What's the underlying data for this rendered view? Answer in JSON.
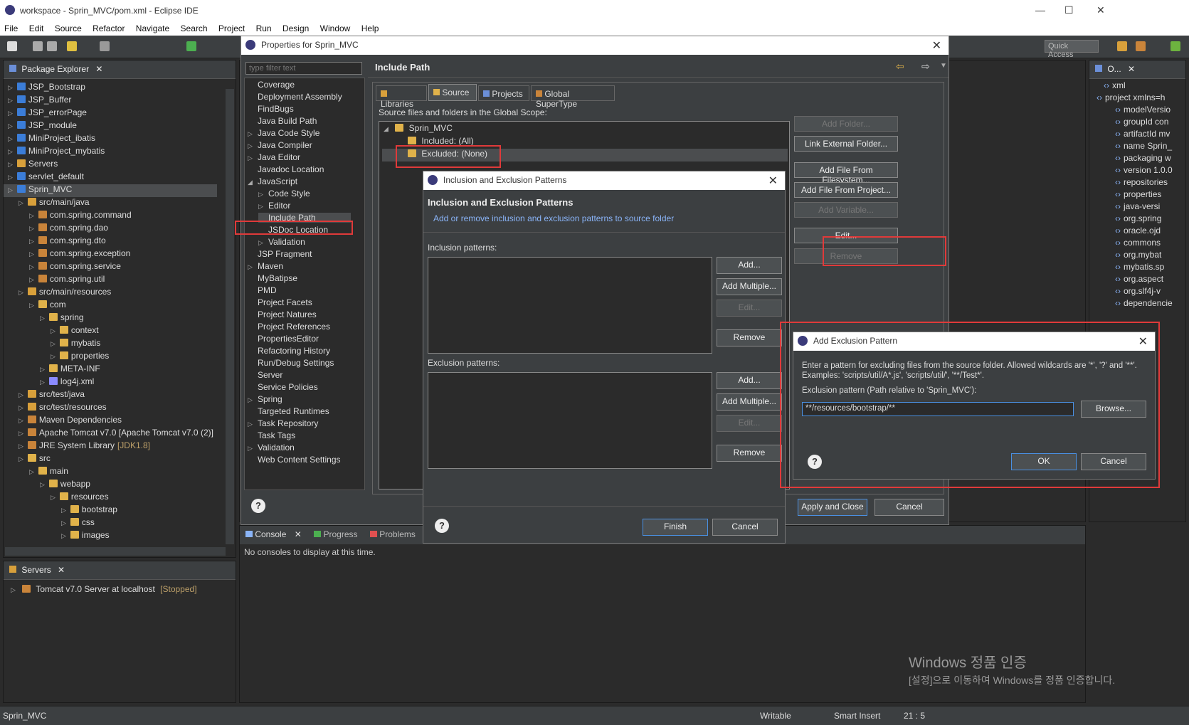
{
  "window": {
    "title": "workspace - Sprin_MVC/pom.xml - Eclipse IDE",
    "min": "—",
    "max": "☐",
    "close": "✕"
  },
  "menu": [
    "File",
    "Edit",
    "Source",
    "Refactor",
    "Navigate",
    "Search",
    "Project",
    "Run",
    "Design",
    "Window",
    "Help"
  ],
  "quick_access": "Quick Access",
  "package_explorer": {
    "tab": "Package Explorer",
    "items": [
      {
        "label": "JSP_Bootstrap",
        "indent": 0,
        "color": "#3b7dd8"
      },
      {
        "label": "JSP_Buffer",
        "indent": 0,
        "color": "#3b7dd8"
      },
      {
        "label": "JSP_errorPage",
        "indent": 0,
        "color": "#3b7dd8"
      },
      {
        "label": "JSP_module",
        "indent": 0,
        "color": "#3b7dd8"
      },
      {
        "label": "MiniProject_ibatis",
        "indent": 0,
        "color": "#3b7dd8"
      },
      {
        "label": "MiniProject_mybatis",
        "indent": 0,
        "color": "#3b7dd8"
      },
      {
        "label": "Servers",
        "indent": 0,
        "color": "#d8a03b"
      },
      {
        "label": "servlet_default",
        "indent": 0,
        "color": "#3b7dd8"
      },
      {
        "label": "Sprin_MVC",
        "indent": 0,
        "color": "#3b7dd8",
        "selected": true
      },
      {
        "label": "src/main/java",
        "indent": 1,
        "color": "#d8a03b"
      },
      {
        "label": "com.spring.command",
        "indent": 2,
        "color": "#c9843a"
      },
      {
        "label": "com.spring.dao",
        "indent": 2,
        "color": "#c9843a"
      },
      {
        "label": "com.spring.dto",
        "indent": 2,
        "color": "#c9843a"
      },
      {
        "label": "com.spring.exception",
        "indent": 2,
        "color": "#c9843a"
      },
      {
        "label": "com.spring.service",
        "indent": 2,
        "color": "#c9843a"
      },
      {
        "label": "com.spring.util",
        "indent": 2,
        "color": "#c9843a"
      },
      {
        "label": "src/main/resources",
        "indent": 1,
        "color": "#d8a03b"
      },
      {
        "label": "com",
        "indent": 2,
        "color": "#e0b24a"
      },
      {
        "label": "spring",
        "indent": 3,
        "color": "#e0b24a"
      },
      {
        "label": "context",
        "indent": 4,
        "color": "#e0b24a"
      },
      {
        "label": "mybatis",
        "indent": 4,
        "color": "#e0b24a"
      },
      {
        "label": "properties",
        "indent": 4,
        "color": "#e0b24a"
      },
      {
        "label": "META-INF",
        "indent": 3,
        "color": "#e0b24a"
      },
      {
        "label": "log4j.xml",
        "indent": 3,
        "color": "#8a8aff"
      },
      {
        "label": "src/test/java",
        "indent": 1,
        "color": "#d8a03b"
      },
      {
        "label": "src/test/resources",
        "indent": 1,
        "color": "#d8a03b"
      },
      {
        "label": "Maven Dependencies",
        "indent": 1,
        "color": "#c9843a"
      },
      {
        "label": "Apache Tomcat v7.0 [Apache Tomcat v7.0 (2)]",
        "indent": 1,
        "color": "#c9843a"
      },
      {
        "label": "JRE System Library",
        "suffix": "[JDK1.8]",
        "indent": 1,
        "color": "#c9843a"
      },
      {
        "label": "src",
        "indent": 1,
        "color": "#e0b24a"
      },
      {
        "label": "main",
        "indent": 2,
        "color": "#e0b24a"
      },
      {
        "label": "webapp",
        "indent": 3,
        "color": "#e0b24a"
      },
      {
        "label": "resources",
        "indent": 4,
        "color": "#e0b24a"
      },
      {
        "label": "bootstrap",
        "indent": 5,
        "color": "#e0b24a"
      },
      {
        "label": "css",
        "indent": 5,
        "color": "#e0b24a"
      },
      {
        "label": "images",
        "indent": 5,
        "color": "#e0b24a"
      }
    ]
  },
  "servers": {
    "tab": "Servers",
    "item": "Tomcat v7.0 Server at localhost",
    "status": "[Stopped]"
  },
  "outline": {
    "tab": "O...",
    "items": [
      "xml",
      "project xmlns=h",
      "modelVersio",
      "groupId  con",
      "artifactId  mv",
      "name  Sprin_",
      "packaging  w",
      "version  1.0.0",
      "repositories",
      "properties",
      "java-versi",
      "org.spring",
      "oracle.ojd",
      "commons",
      "org.mybat",
      "mybatis.sp",
      "org.aspect",
      "org.slf4j-v",
      "dependencie"
    ]
  },
  "console": {
    "tabs": [
      "Console",
      "Progress",
      "Problems"
    ],
    "message": "No consoles to display at this time."
  },
  "watermark": {
    "line1": "Windows 정품 인증",
    "line2": "[설정]으로 이동하여 Windows를 정품 인증합니다."
  },
  "statusbar": {
    "left": "Sprin_MVC",
    "writable": "Writable",
    "insert": "Smart Insert",
    "pos": "21 : 5"
  },
  "properties_dialog": {
    "title": "Properties for Sprin_MVC",
    "filter_placeholder": "type filter text",
    "header": "Include Path",
    "nav": [
      {
        "label": "Coverage",
        "indent": 0
      },
      {
        "label": "Deployment Assembly",
        "indent": 0
      },
      {
        "label": "FindBugs",
        "indent": 0
      },
      {
        "label": "Java Build Path",
        "indent": 0
      },
      {
        "label": "Java Code Style",
        "indent": 0,
        "exp": "▷"
      },
      {
        "label": "Java Compiler",
        "indent": 0,
        "exp": "▷"
      },
      {
        "label": "Java Editor",
        "indent": 0,
        "exp": "▷"
      },
      {
        "label": "Javadoc Location",
        "indent": 0
      },
      {
        "label": "JavaScript",
        "indent": 0,
        "exp": "◢"
      },
      {
        "label": "Code Style",
        "indent": 1,
        "exp": "▷"
      },
      {
        "label": "Editor",
        "indent": 1,
        "exp": "▷"
      },
      {
        "label": "Include Path",
        "indent": 1,
        "selected": true
      },
      {
        "label": "JSDoc Location",
        "indent": 1
      },
      {
        "label": "Validation",
        "indent": 1,
        "exp": "▷"
      },
      {
        "label": "JSP Fragment",
        "indent": 0
      },
      {
        "label": "Maven",
        "indent": 0,
        "exp": "▷"
      },
      {
        "label": "MyBatipse",
        "indent": 0
      },
      {
        "label": "PMD",
        "indent": 0
      },
      {
        "label": "Project Facets",
        "indent": 0
      },
      {
        "label": "Project Natures",
        "indent": 0
      },
      {
        "label": "Project References",
        "indent": 0
      },
      {
        "label": "PropertiesEditor",
        "indent": 0
      },
      {
        "label": "Refactoring History",
        "indent": 0
      },
      {
        "label": "Run/Debug Settings",
        "indent": 0
      },
      {
        "label": "Server",
        "indent": 0
      },
      {
        "label": "Service Policies",
        "indent": 0
      },
      {
        "label": "Spring",
        "indent": 0,
        "exp": "▷"
      },
      {
        "label": "Targeted Runtimes",
        "indent": 0
      },
      {
        "label": "Task Repository",
        "indent": 0,
        "exp": "▷"
      },
      {
        "label": "Task Tags",
        "indent": 0
      },
      {
        "label": "Validation",
        "indent": 0,
        "exp": "▷"
      },
      {
        "label": "Web Content Settings",
        "indent": 0
      }
    ],
    "tabs": [
      "Libraries",
      "Source",
      "Projects",
      "Global SuperType"
    ],
    "scope_label": "Source files and folders in the Global Scope:",
    "tree": {
      "root": "Sprin_MVC",
      "included": "Included: (All)",
      "excluded": "Excluded: (None)"
    },
    "side_buttons": [
      "Add Folder...",
      "Link External Folder...",
      "Add File From Filesystem...",
      "Add File From Project...",
      "Add Variable...",
      "Edit...",
      "Remove"
    ],
    "apply_close": "Apply and Close",
    "cancel": "Cancel"
  },
  "incl_dialog": {
    "title": "Inclusion and Exclusion Patterns",
    "header": "Inclusion and Exclusion Patterns",
    "subheader": "Add or remove inclusion and exclusion patterns to source folder",
    "inclusion_label": "Inclusion patterns:",
    "exclusion_label": "Exclusion patterns:",
    "buttons": [
      "Add...",
      "Add Multiple...",
      "Edit...",
      "Remove"
    ],
    "finish": "Finish",
    "cancel": "Cancel"
  },
  "excl_dialog": {
    "title": "Add Exclusion Pattern",
    "description": "Enter a pattern for excluding files from the source folder. Allowed wildcards are '*', '?' and '**'. Examples: 'scripts/util/A*.js', 'scripts/util/', '**/Test*'.",
    "field_label": "Exclusion pattern (Path relative to 'Sprin_MVC'):",
    "field_value": "**/resources/bootstrap/**",
    "browse": "Browse...",
    "ok": "OK",
    "cancel": "Cancel"
  }
}
